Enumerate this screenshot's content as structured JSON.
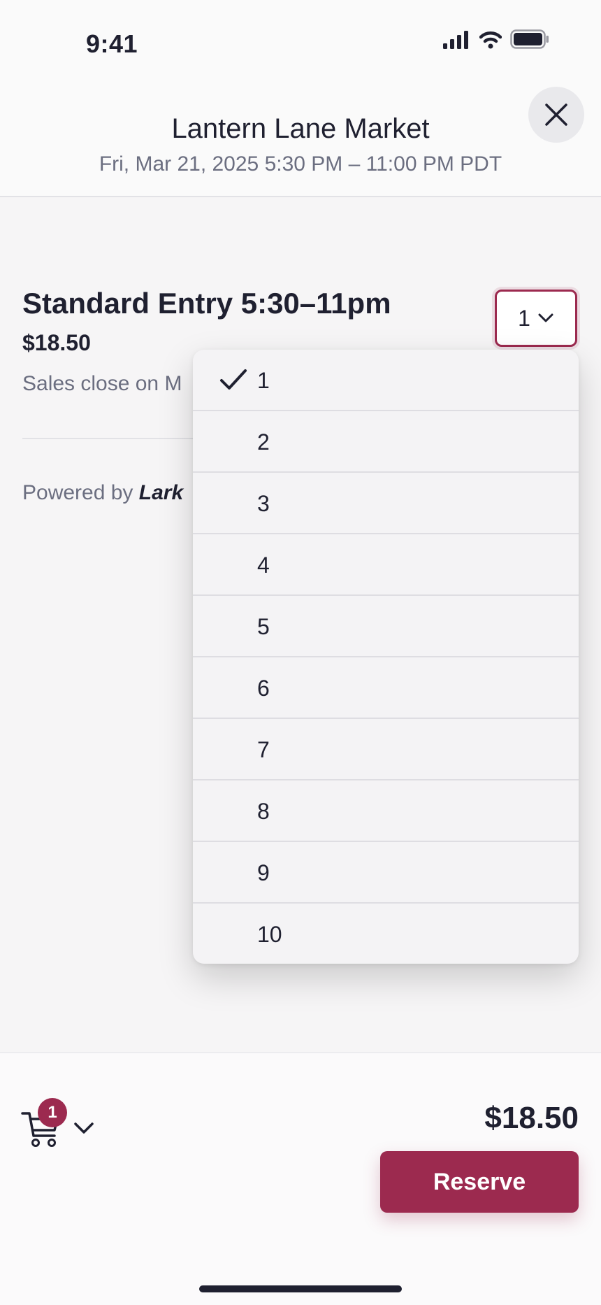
{
  "status_bar": {
    "time": "9:41"
  },
  "header": {
    "title": "Lantern Lane Market",
    "date": "Fri, Mar 21, 2025 5:30 PM – 11:00 PM PDT"
  },
  "ticket": {
    "name": "Standard Entry 5:30–11pm",
    "price": "$18.50",
    "sales_close": "Sales close on M",
    "selected_quantity": "1"
  },
  "powered_by": {
    "prefix": "Powered by",
    "brand": "Lark"
  },
  "quantity_dropdown": {
    "options": [
      "1",
      "2",
      "3",
      "4",
      "5",
      "6",
      "7",
      "8",
      "9",
      "10"
    ],
    "selected": "1"
  },
  "footer": {
    "cart_count": "1",
    "total": "$18.50",
    "reserve_label": "Reserve"
  },
  "colors": {
    "accent": "#9c2a4f",
    "text": "#1f2030",
    "muted": "#6b6e80"
  }
}
